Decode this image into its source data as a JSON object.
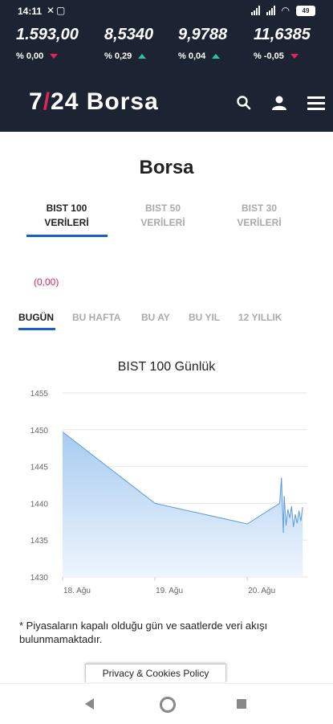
{
  "status_bar": {
    "time": "14:11",
    "battery": "49"
  },
  "ticker": [
    {
      "value": "1.593,00",
      "change": "% 0,00",
      "direction": "down"
    },
    {
      "value": "8,5340",
      "change": "% 0,29",
      "direction": "up"
    },
    {
      "value": "9,9788",
      "change": "% 0,04",
      "direction": "up"
    },
    {
      "value": "11,6385",
      "change": "% -0,05",
      "direction": "down"
    }
  ],
  "header": {
    "logo_number": "7",
    "logo_slash": "/",
    "logo_rest": "24 Borsa"
  },
  "page_title": "Borsa",
  "index_tabs": [
    {
      "line1": "BIST 100",
      "line2": "VERİLERİ",
      "active": true
    },
    {
      "line1": "BIST 50",
      "line2": "VERİLERİ",
      "active": false
    },
    {
      "line1": "BIST 30",
      "line2": "VERİLERİ",
      "active": false
    }
  ],
  "change_text": "(0,00)",
  "period_tabs": [
    "BUGÜN",
    "BU HAFTA",
    "BU AY",
    "BU YIL",
    "12 YILLIK"
  ],
  "chart_data": {
    "type": "area",
    "title": "BIST 100 Günlük",
    "x_ticks": [
      "18. Ağu",
      "19. Ağu",
      "20. Ağu"
    ],
    "y_ticks": [
      1430,
      1435,
      1440,
      1445,
      1450,
      1455
    ],
    "ylim": [
      1430,
      1455
    ],
    "xlim": [
      0,
      2.65
    ],
    "grid": true,
    "points": [
      {
        "x": 0.0,
        "y": 1449.7
      },
      {
        "x": 1.0,
        "y": 1440.0
      },
      {
        "x": 2.0,
        "y": 1437.2
      },
      {
        "x": 2.35,
        "y": 1440.0
      },
      {
        "x": 2.37,
        "y": 1443.5
      },
      {
        "x": 2.39,
        "y": 1436.0
      },
      {
        "x": 2.4,
        "y": 1441.0
      },
      {
        "x": 2.42,
        "y": 1437.0
      },
      {
        "x": 2.44,
        "y": 1439.2
      },
      {
        "x": 2.46,
        "y": 1438.0
      },
      {
        "x": 2.48,
        "y": 1439.6
      },
      {
        "x": 2.5,
        "y": 1436.8
      },
      {
        "x": 2.52,
        "y": 1438.5
      },
      {
        "x": 2.54,
        "y": 1437.3
      },
      {
        "x": 2.56,
        "y": 1439.0
      },
      {
        "x": 2.58,
        "y": 1437.6
      },
      {
        "x": 2.6,
        "y": 1439.5
      }
    ],
    "line_color": "#5b9be0",
    "fill_color": "#cfe3f8"
  },
  "footnote": "* Piyasaların kapalı olduğu gün ve saatlerde veri akışı bulunmamaktadır.",
  "privacy_label": "Privacy & Cookies Policy"
}
